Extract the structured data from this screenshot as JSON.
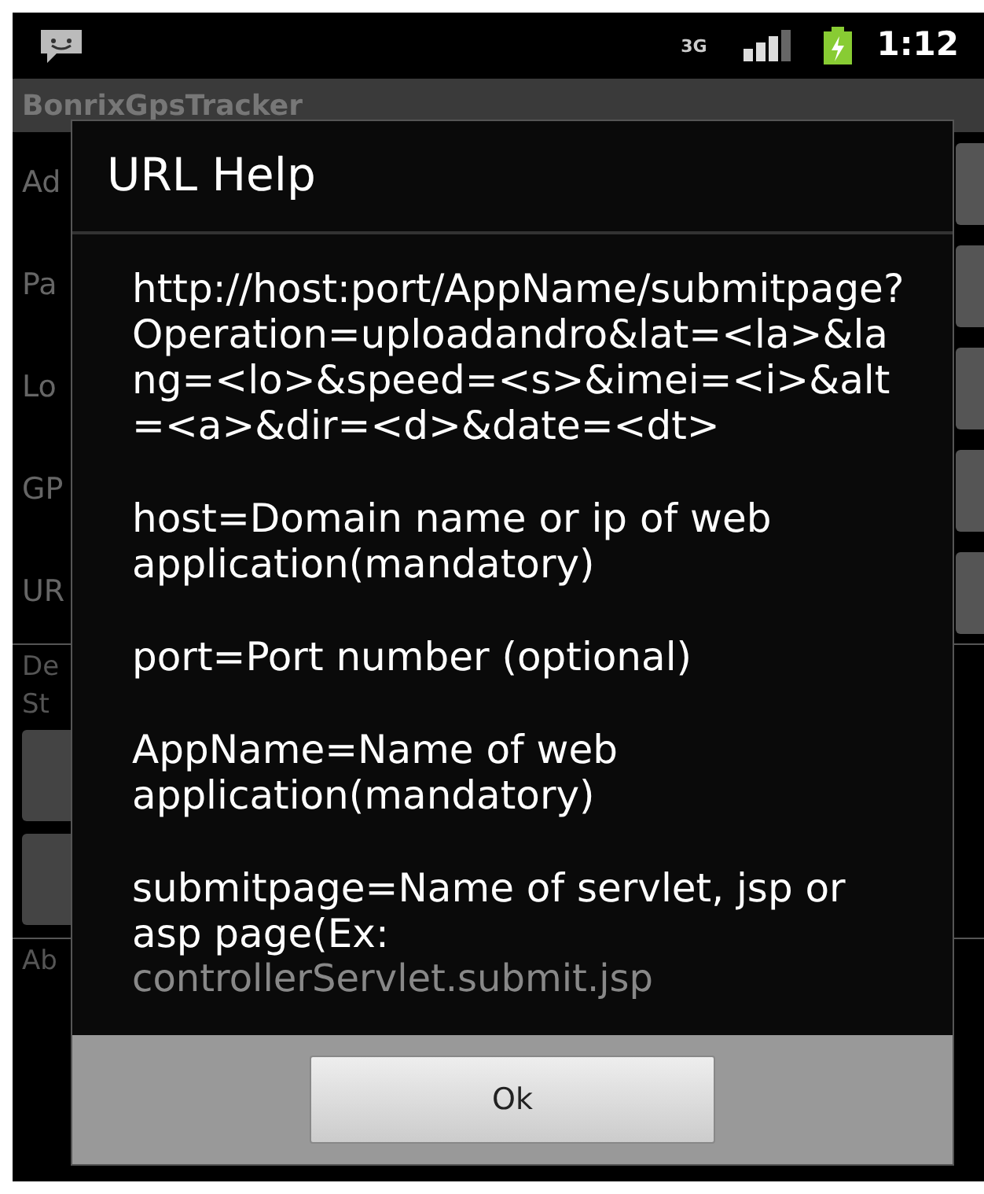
{
  "status_bar": {
    "network_type": "3G",
    "time": "1:12"
  },
  "app": {
    "title": "BonrixGpsTracker",
    "labels": [
      "Ad",
      "Pa",
      "Lo",
      "GP",
      "UR"
    ],
    "status_labels": [
      "De",
      "St"
    ],
    "about_label": "Ab"
  },
  "dialog": {
    "title": "URL Help",
    "paragraphs": [
      "http://host:port/AppName/submitpage?Operation=uploadandro&lat=<la>&lang=<lo>&speed=<s>&imei=<i>&alt=<a>&dir=<d>&date=<dt>",
      "host=Domain name or ip of web application(mandatory)",
      "port=Port number (optional)",
      "AppName=Name of web application(mandatory)",
      "submitpage=Name of servlet, jsp or asp page(Ex:"
    ],
    "cut_line": "controllerServlet.submit.jsp",
    "buttons": [
      "Ok"
    ]
  }
}
